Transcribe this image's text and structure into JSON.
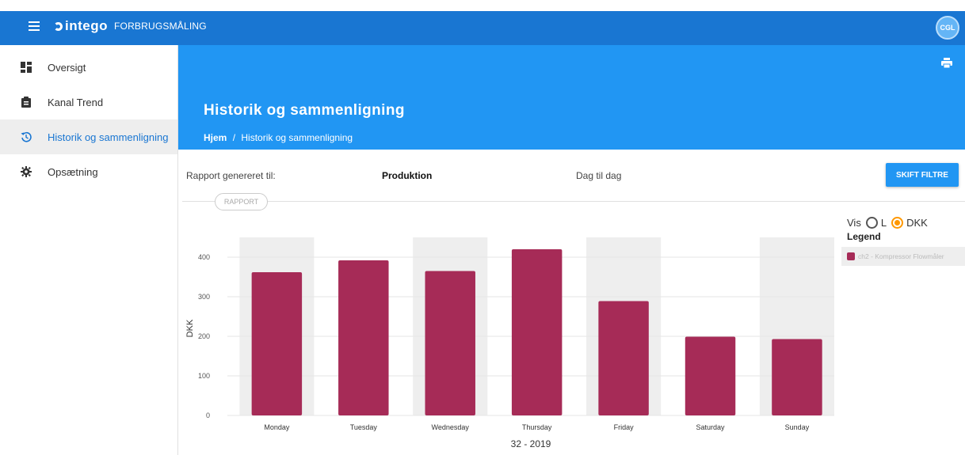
{
  "app": {
    "brand": "intego",
    "title": "FORBRUGSMÅLING",
    "user_initials": "CGL"
  },
  "sidebar": {
    "items": [
      {
        "label": "Oversigt",
        "icon": "dashboard-icon",
        "active": false
      },
      {
        "label": "Kanal Trend",
        "icon": "clipboard-icon",
        "active": false
      },
      {
        "label": "Historik og sammenligning",
        "icon": "history-icon",
        "active": true
      },
      {
        "label": "Opsætning",
        "icon": "gear-icon",
        "active": false
      }
    ]
  },
  "header": {
    "title": "Historik og sammenligning",
    "breadcrumb_home": "Hjem",
    "breadcrumb_sep": "/",
    "breadcrumb_current": "Historik og sammenligning"
  },
  "filters": {
    "report_label": "Rapport genereret til:",
    "report_value": "Produktion",
    "period": "Dag til dag",
    "change_button": "SKIFT FILTRE",
    "rapport_chip": "RAPPORT"
  },
  "display": {
    "vis_label": "Vis",
    "unit_l": "L",
    "unit_dkk": "DKK",
    "selected_unit": "DKK",
    "legend_title": "Legend"
  },
  "colors": {
    "accent": "#2196f3",
    "topbar": "#1976d2",
    "bar": "#a62b57",
    "radio_selected": "#ff9800"
  },
  "chart_data": {
    "type": "bar",
    "categories": [
      "Monday",
      "Tuesday",
      "Wednesday",
      "Thursday",
      "Friday",
      "Saturday",
      "Sunday"
    ],
    "series": [
      {
        "name": "ch2 - Kompressor Flowmåler",
        "values": [
          362,
          392,
          365,
          420,
          289,
          199,
          193
        ]
      }
    ],
    "xlabel": "32 - 2019",
    "ylabel": "DKK",
    "ylim": [
      0,
      450
    ],
    "yticks": [
      0,
      100,
      200,
      300,
      400
    ],
    "grid": true,
    "alternate_band_shading": true,
    "legend_placement": "right"
  }
}
